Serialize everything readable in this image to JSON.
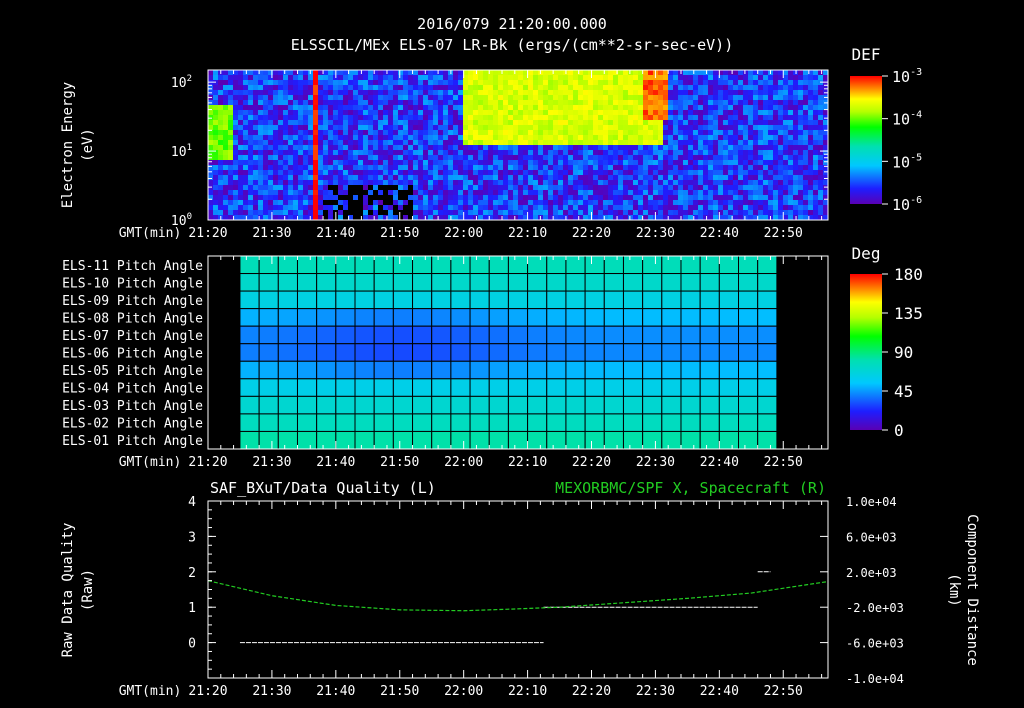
{
  "header": {
    "title_line1": "2016/079 21:20:00.000",
    "title_line2": "ELSSCIL/MEx ELS-07 LR-Bk  (ergs/(cm**2-sr-sec-eV))"
  },
  "time_axis": {
    "label": "GMT(min)",
    "ticks": [
      "21:20",
      "21:30",
      "21:40",
      "21:50",
      "22:00",
      "22:10",
      "22:20",
      "22:30",
      "22:40",
      "22:50"
    ],
    "range_min": [
      0,
      97
    ]
  },
  "colors": {
    "background": "#000000",
    "text": "#ffffff",
    "spacecraft_line": "#22cc22",
    "quality_line": "#ffffff",
    "grid": "#000000"
  },
  "chart_data": [
    {
      "type": "heatmap",
      "name": "electron-spectrogram",
      "ylabel": [
        "Electron Energy",
        "(eV)"
      ],
      "y_scale": "log",
      "ylim": [
        1,
        150
      ],
      "y_ticks": [
        {
          "base": "10",
          "exp": "2",
          "value": 100
        },
        {
          "base": "10",
          "exp": "1",
          "value": 10
        },
        {
          "base": "10",
          "exp": "0",
          "value": 1
        }
      ],
      "colorbar": {
        "title": "DEF",
        "scale": "log",
        "range": [
          1e-06,
          0.001
        ],
        "ticks": [
          {
            "base": "10",
            "exp": "-3",
            "value": 0.001
          },
          {
            "base": "10",
            "exp": "-4",
            "value": 0.0001
          },
          {
            "base": "10",
            "exp": "-5",
            "value": 1e-05
          },
          {
            "base": "10",
            "exp": "-6",
            "value": 1e-06
          }
        ]
      },
      "features": [
        {
          "time_min": [
            0,
            4
          ],
          "energy_eV": [
            8,
            50
          ],
          "level": 0.0001
        },
        {
          "time_min": [
            16.5,
            17.5
          ],
          "energy_eV": [
            1,
            150
          ],
          "level": 0.001
        },
        {
          "time_min": [
            40,
            71
          ],
          "energy_eV": [
            12,
            150
          ],
          "level": 0.0002
        },
        {
          "time_min": [
            68,
            72
          ],
          "energy_eV": [
            30,
            150
          ],
          "level": 0.0006
        }
      ]
    },
    {
      "type": "heatmap",
      "name": "pitch-angle",
      "rows": [
        "ELS-11 Pitch Angle",
        "ELS-10 Pitch Angle",
        "ELS-09 Pitch Angle",
        "ELS-08 Pitch Angle",
        "ELS-07 Pitch Angle",
        "ELS-06 Pitch Angle",
        "ELS-05 Pitch Angle",
        "ELS-04 Pitch Angle",
        "ELS-03 Pitch Angle",
        "ELS-02 Pitch Angle",
        "ELS-01 Pitch Angle"
      ],
      "data_time_range_min": [
        5,
        89
      ],
      "cell_minutes": 3,
      "row_values_deg": [
        78,
        72,
        64,
        52,
        43,
        42,
        52,
        62,
        70,
        76,
        82
      ],
      "dip": {
        "center_min": 30,
        "width_min": 18,
        "depth_deg": 12,
        "rows": [
          3,
          4,
          5,
          6
        ]
      },
      "colorbar": {
        "title": "Deg",
        "range": [
          0,
          180
        ],
        "ticks": [
          "180",
          "135",
          "90",
          "45",
          "0"
        ]
      }
    },
    {
      "type": "line",
      "name": "data-quality",
      "left_title": "SAF_BXuT/Data Quality (L)",
      "right_title": "MEXORBMC/SPF X, Spacecraft (R)",
      "ylabel_left": [
        "Raw Data Quality",
        "(Raw)"
      ],
      "ylabel_right": [
        "Component Distance",
        "(km)"
      ],
      "ylim_left": [
        -1,
        4
      ],
      "y_ticks_left": [
        "4",
        "3",
        "2",
        "1",
        "0"
      ],
      "ylim_right": [
        -10000,
        10000
      ],
      "y_ticks_right": [
        "1.0e+04",
        "6.0e+03",
        "2.0e+03",
        "-2.0e+03",
        "-6.0e+03",
        "-1.0e+04"
      ],
      "series": [
        {
          "axis": "left",
          "segments": [
            {
              "x": [
                5,
                52.5
              ],
              "y": 0
            },
            {
              "x": [
                52.5,
                86
              ],
              "y": 1
            },
            {
              "x": [
                86,
                88
              ],
              "y": 2
            }
          ]
        },
        {
          "axis": "right",
          "x": [
            0,
            10,
            20,
            30,
            40,
            48,
            55,
            65,
            75,
            85,
            97
          ],
          "y": [
            1000,
            -700,
            -1800,
            -2300,
            -2400,
            -2200,
            -2000,
            -1500,
            -1000,
            -400,
            900
          ]
        }
      ]
    }
  ]
}
